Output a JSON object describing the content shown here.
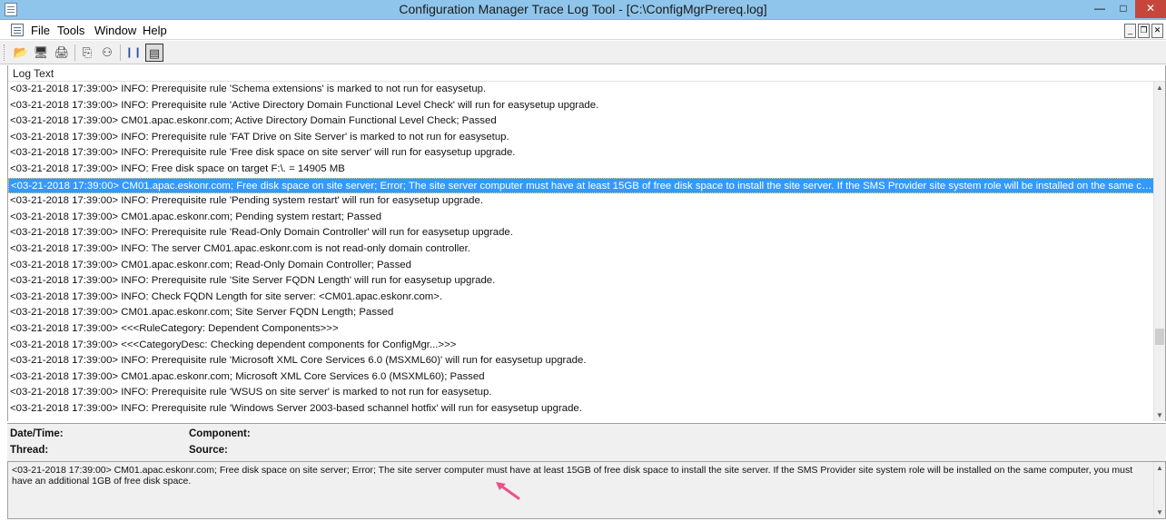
{
  "window": {
    "title": "Configuration Manager Trace Log Tool - [C:\\ConfigMgrPrereq.log]",
    "minimize_glyph": "—",
    "maximize_glyph": "□",
    "close_glyph": "✕"
  },
  "menu": {
    "items": [
      "File",
      "Tools",
      "Window",
      "Help"
    ],
    "mdi_min": "_",
    "mdi_restore": "❐",
    "mdi_close": "✕"
  },
  "toolbar": {
    "buttons": [
      {
        "icon": "open-folder-icon",
        "glyph": "📂"
      },
      {
        "icon": "monitor-icon",
        "glyph": "🖥"
      },
      {
        "icon": "print-icon",
        "glyph": "🖨"
      },
      {
        "icon": "copy-icon",
        "glyph": "⎘"
      },
      {
        "icon": "find-binoculars-icon",
        "glyph": "⚇"
      },
      {
        "icon": "pause-icon",
        "glyph": "❙❙"
      },
      {
        "icon": "details-pane-icon",
        "glyph": "▤"
      }
    ]
  },
  "log": {
    "column_header": "Log Text",
    "rows": [
      "<03-21-2018 17:39:00> INFO: Prerequisite rule 'Schema extensions' is marked to not run for easysetup.",
      "<03-21-2018 17:39:00> INFO: Prerequisite rule 'Active Directory Domain Functional Level Check' will run for easysetup upgrade.",
      "<03-21-2018 17:39:00> CM01.apac.eskonr.com;    Active Directory Domain Functional Level Check;    Passed",
      "<03-21-2018 17:39:00> INFO: Prerequisite rule 'FAT Drive on Site Server' is marked to not run for easysetup.",
      "<03-21-2018 17:39:00> INFO: Prerequisite rule 'Free disk space on site server' will run for easysetup upgrade.",
      "<03-21-2018 17:39:00> INFO: Free disk space on target F:\\. = 14905 MB",
      "<03-21-2018 17:39:00> CM01.apac.eskonr.com;    Free disk space on site server;    Error;    The site server computer must have at least 15GB of free disk space to install the site server. If the SMS Provider site system role will be installed on the same computer,...",
      "<03-21-2018 17:39:00> INFO: Prerequisite rule 'Pending system restart' will run for easysetup upgrade.",
      "<03-21-2018 17:39:00> CM01.apac.eskonr.com;    Pending system restart;    Passed",
      "<03-21-2018 17:39:00> INFO: Prerequisite rule 'Read-Only Domain Controller' will run for easysetup upgrade.",
      "<03-21-2018 17:39:00> INFO: The server CM01.apac.eskonr.com is not read-only domain controller.",
      "<03-21-2018 17:39:00> CM01.apac.eskonr.com;    Read-Only Domain Controller;    Passed",
      "<03-21-2018 17:39:00> INFO: Prerequisite rule 'Site Server FQDN Length' will run for easysetup upgrade.",
      "<03-21-2018 17:39:00> INFO: Check FQDN Length for site server: <CM01.apac.eskonr.com>.",
      "<03-21-2018 17:39:00> CM01.apac.eskonr.com;    Site Server FQDN Length;    Passed",
      "<03-21-2018 17:39:00> <<<RuleCategory: Dependent Components>>>",
      "<03-21-2018 17:39:00> <<<CategoryDesc: Checking dependent components for ConfigMgr...>>>",
      "<03-21-2018 17:39:00> INFO: Prerequisite rule 'Microsoft XML Core Services 6.0 (MSXML60)' will run for easysetup upgrade.",
      "<03-21-2018 17:39:00> CM01.apac.eskonr.com;    Microsoft XML Core Services 6.0 (MSXML60);    Passed",
      "<03-21-2018 17:39:00> INFO: Prerequisite rule 'WSUS on site server' is marked to not run for easysetup.",
      "<03-21-2018 17:39:00> INFO: Prerequisite rule 'Windows Server 2003-based schannel hotfix' will run for easysetup upgrade."
    ],
    "selected_index": 6
  },
  "details": {
    "date_time_label": "Date/Time:",
    "component_label": "Component:",
    "thread_label": "Thread:",
    "source_label": "Source:"
  },
  "message": {
    "text": "<03-21-2018 17:39:00> CM01.apac.eskonr.com;    Free disk space on site server;    Error;    The site server computer must have at least 15GB of free disk space to install the site server. If the SMS Provider site system role will be installed on the same computer, you must have an additional 1GB of free disk space."
  },
  "colors": {
    "titlebar": "#8fc5ea",
    "selection": "#3399ff",
    "annotation_arrow": "#e8538a"
  }
}
